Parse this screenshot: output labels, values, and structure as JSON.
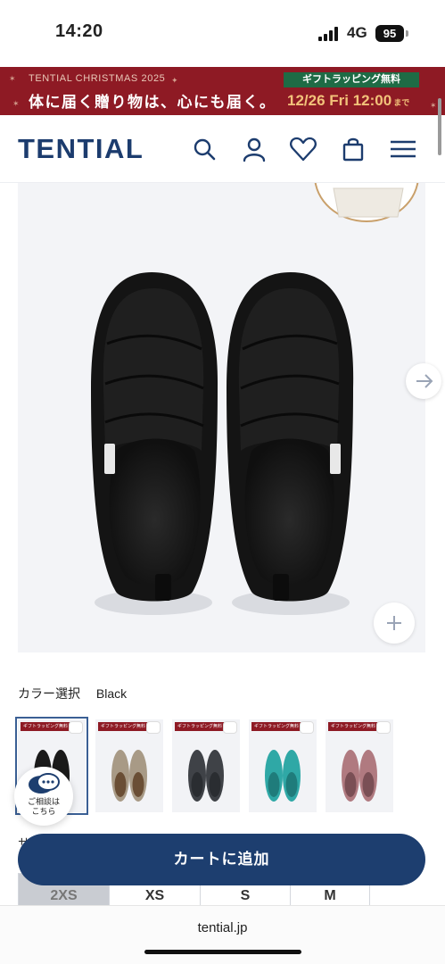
{
  "status_bar": {
    "time": "14:20",
    "network": "4G",
    "battery": "95"
  },
  "banner": {
    "subtitle": "TENTIAL CHRISTMAS 2025",
    "headline": "体に届く贈り物は、心にも届く。",
    "gift_label": "ギフトラッピング無料",
    "date": "12/26 Fri 12:00",
    "date_suffix": "まで",
    "bg_color": "#8e1a24"
  },
  "header": {
    "logo": "TENTIAL",
    "icons": [
      "search-icon",
      "account-icon",
      "favorite-icon",
      "cart-icon",
      "menu-icon"
    ]
  },
  "product": {
    "gallery_next": "arrow-right-icon",
    "zoom": "plus-icon"
  },
  "color_select": {
    "label": "カラー選択",
    "selected": "Black",
    "swatch_tag": "ギフトラッピング無料",
    "swatches": [
      {
        "name": "Black",
        "color": "#1a1a1a",
        "lining": "#2b2b2b"
      },
      {
        "name": "Beige",
        "color": "#a89a86",
        "lining": "#6a4e35"
      },
      {
        "name": "Gray",
        "color": "#3f4247",
        "lining": "#2a2d31"
      },
      {
        "name": "Turquoise",
        "color": "#2fa8a6",
        "lining": "#1f7c7b"
      },
      {
        "name": "Pink",
        "color": "#b07a80",
        "lining": "#7a4f55"
      }
    ]
  },
  "chat": {
    "label_line1": "ご相談は",
    "label_line2": "こちら"
  },
  "size": {
    "peek_label": "サ",
    "options": [
      {
        "label": "2XS",
        "available": false
      },
      {
        "label": "XS",
        "available": true
      },
      {
        "label": "S",
        "available": true
      },
      {
        "label": "M",
        "available": true
      }
    ]
  },
  "cart_button": {
    "label": "カートに追加",
    "color": "#1d3e6f"
  },
  "browser": {
    "url": "tential.jp"
  }
}
